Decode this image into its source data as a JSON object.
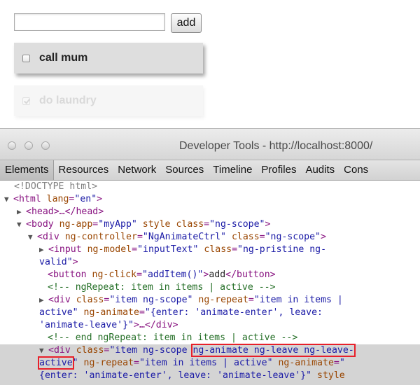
{
  "app": {
    "input_value": "",
    "add_label": "add",
    "items": [
      {
        "label": "call mum",
        "checked": false
      },
      {
        "label": "do laundry",
        "checked": true
      }
    ]
  },
  "devtools": {
    "title": "Developer Tools - http://localhost:8000/",
    "tabs": [
      "Elements",
      "Resources",
      "Network",
      "Sources",
      "Timeline",
      "Profiles",
      "Audits",
      "Cons"
    ],
    "active_tab": "Elements",
    "tree": {
      "doctype": "<!DOCTYPE html>",
      "html_open": "<html",
      "html_attr": "lang",
      "html_val": "\"en\"",
      "head": "<head>…</head>",
      "body_tag": "<body",
      "body_attr1": "ng-app",
      "body_val1": "\"myApp\"",
      "body_attr2": "style",
      "body_attr3": "class",
      "body_val3": "\"ng-scope\"",
      "ctrl_tag": "<div",
      "ctrl_attr1": "ng-controller",
      "ctrl_val1": "\"NgAnimateCtrl\"",
      "ctrl_attr2": "class",
      "ctrl_val2": "\"ng-scope\"",
      "input_tag": "<input",
      "input_attr1": "ng-model",
      "input_val1": "\"inputText\"",
      "input_attr2": "class",
      "input_val2a": "\"ng-pristine ng-",
      "input_val2b": "valid\"",
      "button_tag_open": "<button",
      "button_attr": "ng-click",
      "button_val": "\"addItem()\"",
      "button_text": "add",
      "button_close": "</button>",
      "comment1": "<!-- ngRepeat: item in items | active -->",
      "div1_tag": "<div",
      "div1_attr1": "class",
      "div1_val1": "\"item ng-scope\"",
      "div1_attr2": "ng-repeat",
      "div1_val2a": "\"item in items |",
      "div1_val2b": "active\"",
      "div1_attr3": "ng-animate",
      "div1_val3a": "\"{enter: 'animate-enter', leave:",
      "div1_val3b": "'animate-leave'}\"",
      "div1_end": "…</div>",
      "comment2": "<!-- end ngRepeat: item in items | active -->",
      "div2_tag": "<div",
      "div2_attr1": "class",
      "div2_val1a": "\"item ng-scope ",
      "div2_val1b": "ng-animate ng-leave ng-leave-",
      "div2_val1c": "active",
      "div2_val1d": "\"",
      "div2_attr2": "ng-repeat",
      "div2_val2": "\"item in items | active\"",
      "div2_attr3": "ng-animate",
      "div2_val3a": "\"",
      "div2_val3b": "{enter: 'animate-enter', leave: 'animate-leave'}\"",
      "div2_attr4": "style"
    }
  }
}
